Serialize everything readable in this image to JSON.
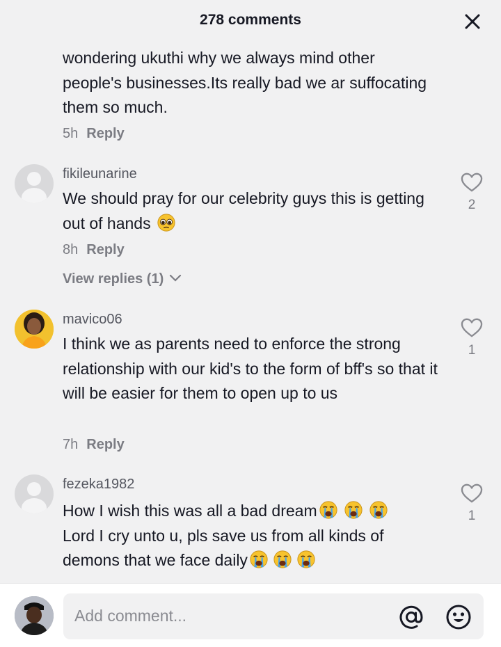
{
  "header": {
    "title": "278 comments",
    "close_icon": "close-icon"
  },
  "comments": [
    {
      "text": "wondering ukuthi why we always mind other people's businesses.Its really bad we ar suffocating them so much.",
      "time": "5h",
      "reply": "Reply"
    },
    {
      "username": "fikileunarine",
      "text": "We should pray for our celebrity guys this is getting out of hands",
      "emoji": [
        "pleading-face-emoji"
      ],
      "time": "8h",
      "reply": "Reply",
      "view_replies": "View replies (1)",
      "likes": "2"
    },
    {
      "username": "mavico06",
      "text": "I think we as parents need to enforce the strong relationship with our kid's to the form of bff's so that it will be easier for them to open up to us",
      "time": "7h",
      "reply": "Reply",
      "likes": "1"
    },
    {
      "username": "fezeka1982",
      "line1": "How I wish this was all a bad dream",
      "line2": "Lord I cry unto u, pls save us from all kinds of",
      "line3": "demons that we face daily",
      "emoji": [
        "crying-face-emoji",
        "crying-face-emoji",
        "crying-face-emoji"
      ],
      "likes": "1"
    }
  ],
  "footer": {
    "placeholder": "Add comment...",
    "at_icon": "at-mention-icon",
    "emoji_icon": "emoji-icon"
  },
  "colors": {
    "background": "#f1f1f2",
    "text": "#161823",
    "muted": "#7b7c83",
    "emoji": "#f7c32e"
  }
}
